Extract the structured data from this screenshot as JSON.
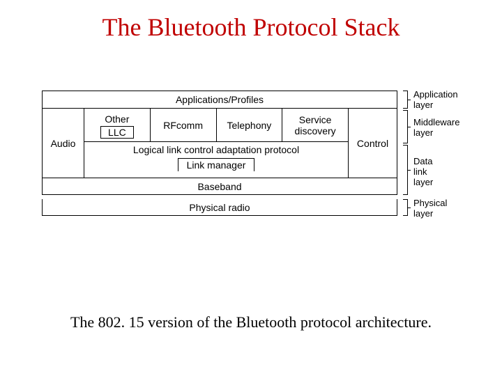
{
  "title": "The Bluetooth Protocol Stack",
  "caption": "The 802. 15 version of the Bluetooth protocol architecture.",
  "stack": {
    "apps": "Applications/Profiles",
    "audio": "Audio",
    "control": "Control",
    "other": "Other",
    "llc": "LLC",
    "rfcomm": "RFcomm",
    "telephony": "Telephony",
    "service_discovery_l1": "Service",
    "service_discovery_l2": "discovery",
    "llcap": "Logical link control adaptation protocol",
    "link_manager": "Link manager",
    "baseband": "Baseband",
    "physical_radio": "Physical radio"
  },
  "layers": {
    "application_l1": "Application",
    "application_l2": "layer",
    "middleware_l1": "Middleware",
    "middleware_l2": "layer",
    "datalink_l1": "Data",
    "datalink_l2": "link",
    "datalink_l3": "layer",
    "physical_l1": "Physical",
    "physical_l2": "layer"
  }
}
